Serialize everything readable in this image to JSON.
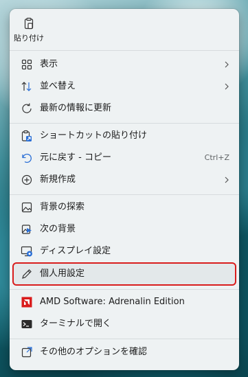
{
  "quick_actions": [
    {
      "label": "貼り付け",
      "icon": "clipboard-paste-icon"
    }
  ],
  "menu": {
    "group1": [
      {
        "label": "表示",
        "icon": "grid-view-icon",
        "submenu": true
      },
      {
        "label": "並べ替え",
        "icon": "sort-icon",
        "submenu": true
      },
      {
        "label": "最新の情報に更新",
        "icon": "refresh-icon"
      }
    ],
    "group2": [
      {
        "label": "ショートカットの貼り付け",
        "icon": "paste-shortcut-icon"
      },
      {
        "label": "元に戻す - コピー",
        "icon": "undo-icon",
        "shortcut": "Ctrl+Z"
      },
      {
        "label": "新規作成",
        "icon": "new-plus-icon",
        "submenu": true
      }
    ],
    "group3": [
      {
        "label": "背景の探索",
        "icon": "image-icon"
      },
      {
        "label": "次の背景",
        "icon": "next-background-icon"
      },
      {
        "label": "ディスプレイ設定",
        "icon": "display-settings-icon"
      },
      {
        "label": "個人用設定",
        "icon": "pen-icon",
        "highlighted": true
      }
    ],
    "group4": [
      {
        "label": "AMD Software: Adrenalin Edition",
        "icon": "amd-logo-icon"
      },
      {
        "label": "ターミナルで開く",
        "icon": "terminal-icon"
      }
    ],
    "group5": [
      {
        "label": "その他のオプションを確認",
        "icon": "more-options-icon"
      }
    ]
  },
  "colors": {
    "menu_bg": "#eef2f3",
    "highlight_border": "#d91c1c",
    "accent_blue": "#2a6fd6",
    "amd_red": "#d91c1c",
    "text": "#1b1b1b"
  }
}
